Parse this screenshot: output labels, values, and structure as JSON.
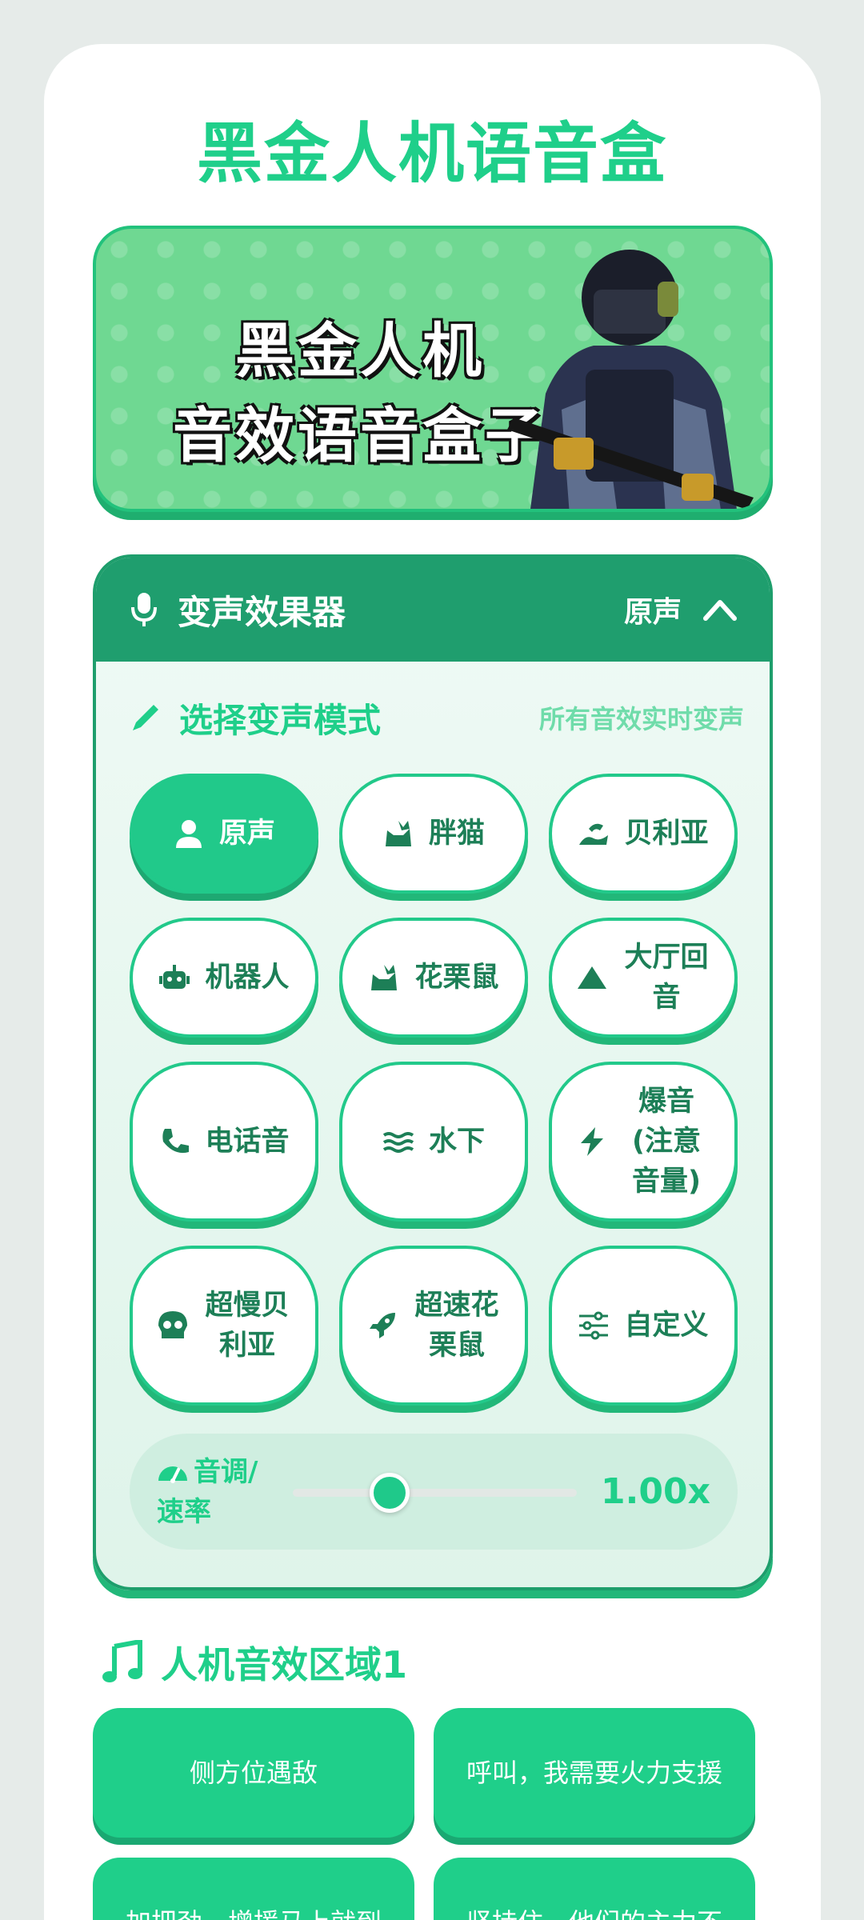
{
  "app": {
    "title": "黑金人机语音盒"
  },
  "banner": {
    "line1": "黑金人机",
    "line2": "音效语音盒子"
  },
  "voice_changer": {
    "title": "变声效果器",
    "current_mode": "原声",
    "mode_label": "选择变声模式",
    "mode_hint": "所有音效实时变声",
    "modes": [
      {
        "label": "原声",
        "icon": "user-icon",
        "active": true
      },
      {
        "label": "胖猫",
        "icon": "cat-icon",
        "active": false
      },
      {
        "label": "贝利亚",
        "icon": "dragon-icon",
        "active": false
      },
      {
        "label": "机器人",
        "icon": "robot-icon",
        "active": false
      },
      {
        "label": "花栗鼠",
        "icon": "cat-icon",
        "active": false
      },
      {
        "label": "大厅回音",
        "icon": "mountain-icon",
        "active": false
      },
      {
        "label": "电话音",
        "icon": "phone-icon",
        "active": false
      },
      {
        "label": "水下",
        "icon": "water-icon",
        "active": false
      },
      {
        "label": "爆音(注意音量)",
        "icon": "bolt-icon",
        "active": false
      },
      {
        "label": "超慢贝利亚",
        "icon": "skull-icon",
        "active": false
      },
      {
        "label": "超速花栗鼠",
        "icon": "rocket-icon",
        "active": false
      },
      {
        "label": "自定义",
        "icon": "sliders-icon",
        "active": false
      }
    ],
    "pitch": {
      "label": "音调/速率",
      "value_text": "1.00x",
      "position_fraction": 0.34
    }
  },
  "sfx_section": {
    "title": "人机音效区域1",
    "items": [
      "侧方位遇敌",
      "呼叫，我需要火力支援",
      "加把劲，增援马上就到",
      "坚持住，他们的主力不"
    ]
  },
  "colors": {
    "accent": "#1fcf8a",
    "header": "#1f9e6e",
    "banner": "#6fd892"
  }
}
